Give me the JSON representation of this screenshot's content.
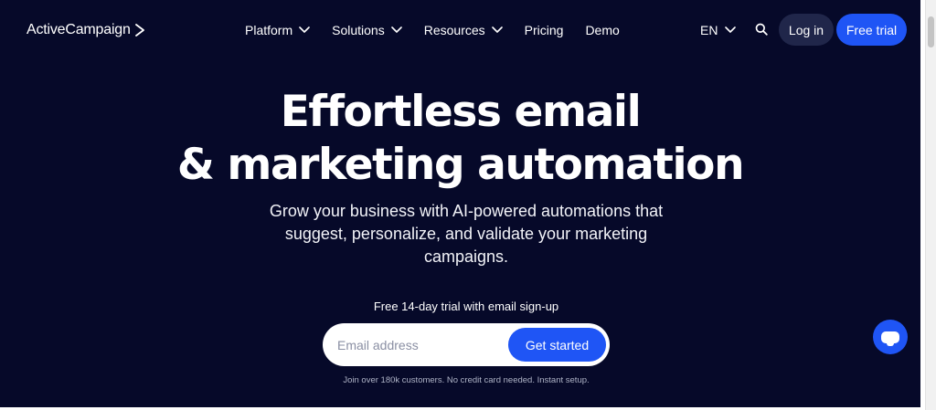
{
  "header": {
    "logo_text": "ActiveCampaign",
    "nav": [
      {
        "label": "Platform",
        "has_dropdown": true
      },
      {
        "label": "Solutions",
        "has_dropdown": true
      },
      {
        "label": "Resources",
        "has_dropdown": true
      },
      {
        "label": "Pricing",
        "has_dropdown": false
      },
      {
        "label": "Demo",
        "has_dropdown": false
      }
    ],
    "language": "EN",
    "login_label": "Log in",
    "trial_label": "Free trial",
    "icons": [
      "chevron-right-icon",
      "chevron-down-icon",
      "search-icon"
    ]
  },
  "hero": {
    "headline_line1": "Effortless email",
    "headline_line2": "& marketing automation",
    "subtitle_line1": "Grow your business with AI-powered automations that",
    "subtitle_line2": "suggest, personalize, and validate your marketing",
    "subtitle_line3": "campaigns.",
    "trial_note": "Free 14-day trial with email sign-up",
    "email_placeholder": "Email address",
    "email_value": "",
    "cta_label": "Get started",
    "fine_print": "Join over 180k customers. No credit card needed. Instant setup."
  },
  "chat": {
    "icon": "chat-bubble-icon"
  },
  "colors": {
    "background": "#060929",
    "accent": "#1f55f5",
    "login_bg": "#20264a",
    "text": "#ffffff"
  }
}
